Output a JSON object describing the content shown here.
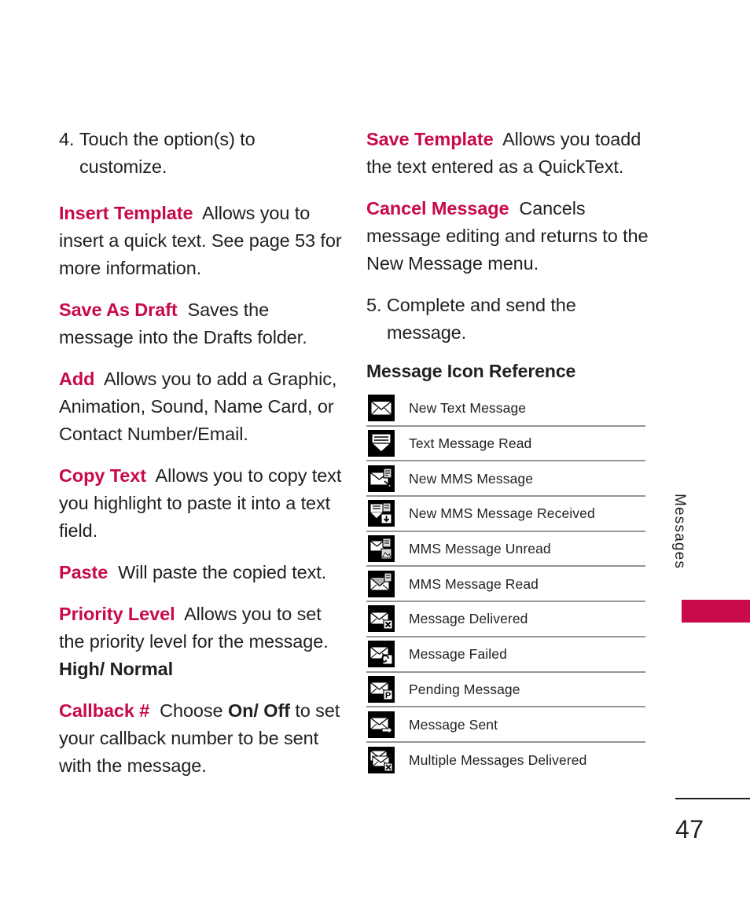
{
  "page": {
    "number": "47",
    "running_head": "Messages",
    "accent_color": "#c80a4b",
    "text_color": "#231f20",
    "rule_color": "#939598"
  },
  "left_column": {
    "step4": {
      "number": "4.",
      "text": "Touch the option(s) to customize."
    },
    "entries": [
      {
        "term": "Insert Template",
        "desc": "Allows you to insert a quick text. See page 53 for more information."
      },
      {
        "term": "Save As Draft",
        "desc": "Saves the message into the Drafts folder."
      },
      {
        "term": "Add",
        "desc": "Allows you to add a Graphic, Animation, Sound, Name Card, or Contact Number/Email."
      },
      {
        "term": "Copy Text",
        "desc": "Allows you to copy text you highlight to paste it into a text field."
      },
      {
        "term": "Paste",
        "desc": "Will paste the copied text."
      },
      {
        "term": "Priority Level",
        "desc": "Allows you to set the priority level for the message. ",
        "bold_tail": "High/ Normal"
      },
      {
        "term": "Callback #",
        "desc_a": "Choose ",
        "bold_mid": "On/ Off",
        "desc_b": " to set your callback number to be sent with the message."
      }
    ]
  },
  "right_column": {
    "entries": [
      {
        "term": "Save Template",
        "desc": "Allows you toadd the text entered as a QuickText."
      },
      {
        "term": "Cancel Message",
        "desc": "Cancels message editing and returns to the New Message menu."
      }
    ],
    "step5": {
      "number": "5.",
      "text": "Complete and send the message."
    },
    "icon_reference": {
      "heading": "Message Icon Reference",
      "rows": [
        {
          "icon": "new-text-message-icon",
          "label": "New Text Message"
        },
        {
          "icon": "text-message-read-icon",
          "label": "Text Message Read"
        },
        {
          "icon": "new-mms-message-icon",
          "label": "New MMS Message"
        },
        {
          "icon": "new-mms-message-received-icon",
          "label": "New MMS Message Received"
        },
        {
          "icon": "mms-message-unread-icon",
          "label": "MMS Message Unread"
        },
        {
          "icon": "mms-message-read-icon",
          "label": "MMS Message Read"
        },
        {
          "icon": "message-delivered-icon",
          "label": "Message Delivered"
        },
        {
          "icon": "message-failed-icon",
          "label": "Message Failed"
        },
        {
          "icon": "pending-message-icon",
          "label": "Pending Message"
        },
        {
          "icon": "message-sent-icon",
          "label": "Message Sent"
        },
        {
          "icon": "multiple-messages-delivered-icon",
          "label": "Multiple Messages Delivered"
        }
      ]
    }
  }
}
